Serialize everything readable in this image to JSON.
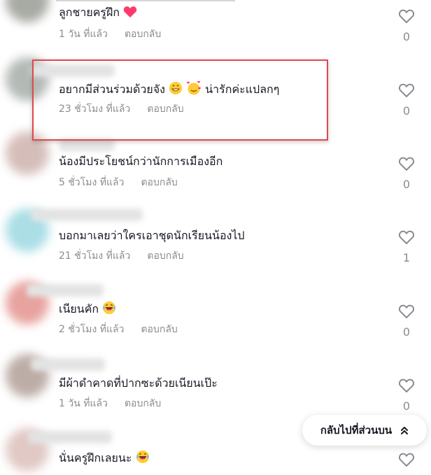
{
  "comments": [
    {
      "text": "ลูกชายครูฝึก",
      "emoji": "heart",
      "time": "1 วัน ที่แล้ว",
      "reply": "ตอบกลับ",
      "likes": "0",
      "avatar_color": "#8b8f86"
    },
    {
      "text": "อยากมีส่วนร่วมด้วยจัง",
      "emoji": "grin-hearts",
      "suffix": "น่ารักค่ะแปลกๆ",
      "time": "23 ชั่วโมง ที่แล้ว",
      "reply": "ตอบกลับ",
      "likes": "0",
      "avatar_color": "#9aa39c"
    },
    {
      "text": "น้องมีประโยชน์กว่านักการเมืองอีก",
      "time": "5 ชั่วโมง ที่แล้ว",
      "reply": "ตอบกลับ",
      "likes": "0",
      "avatar_color": "#c8a9a3"
    },
    {
      "text": "บอกมาเลยว่าใครเอาชุดนักเรียนน้องไป",
      "time": "21 ชั่วโมง ที่แล้ว",
      "reply": "ตอบกลับ",
      "likes": "1",
      "avatar_color": "#8fd3dd"
    },
    {
      "text": "เนียนคัก",
      "emoji": "laugh",
      "time": "2 ชั่วโมง ที่แล้ว",
      "reply": "ตอบกลับ",
      "likes": "0",
      "avatar_color": "#e0857f"
    },
    {
      "text": "มีผ้าดำคาดที่ปากซะด้วยเนียนเป๊ะ",
      "time": "1 วัน ที่แล้ว",
      "reply": "ตอบกลับ",
      "likes": "0",
      "avatar_color": "#a8928a"
    },
    {
      "text": "นั่นครูฝึกเลยนะ",
      "emoji": "laugh",
      "likes": "",
      "avatar_color": "#d7b7b2"
    }
  ],
  "back_to_top": {
    "label": "กลับไปที่ส่วนบน"
  },
  "colors": {
    "highlight": "#e0484c",
    "heart": "#ff3b6b",
    "muted": "#8a8b91"
  }
}
